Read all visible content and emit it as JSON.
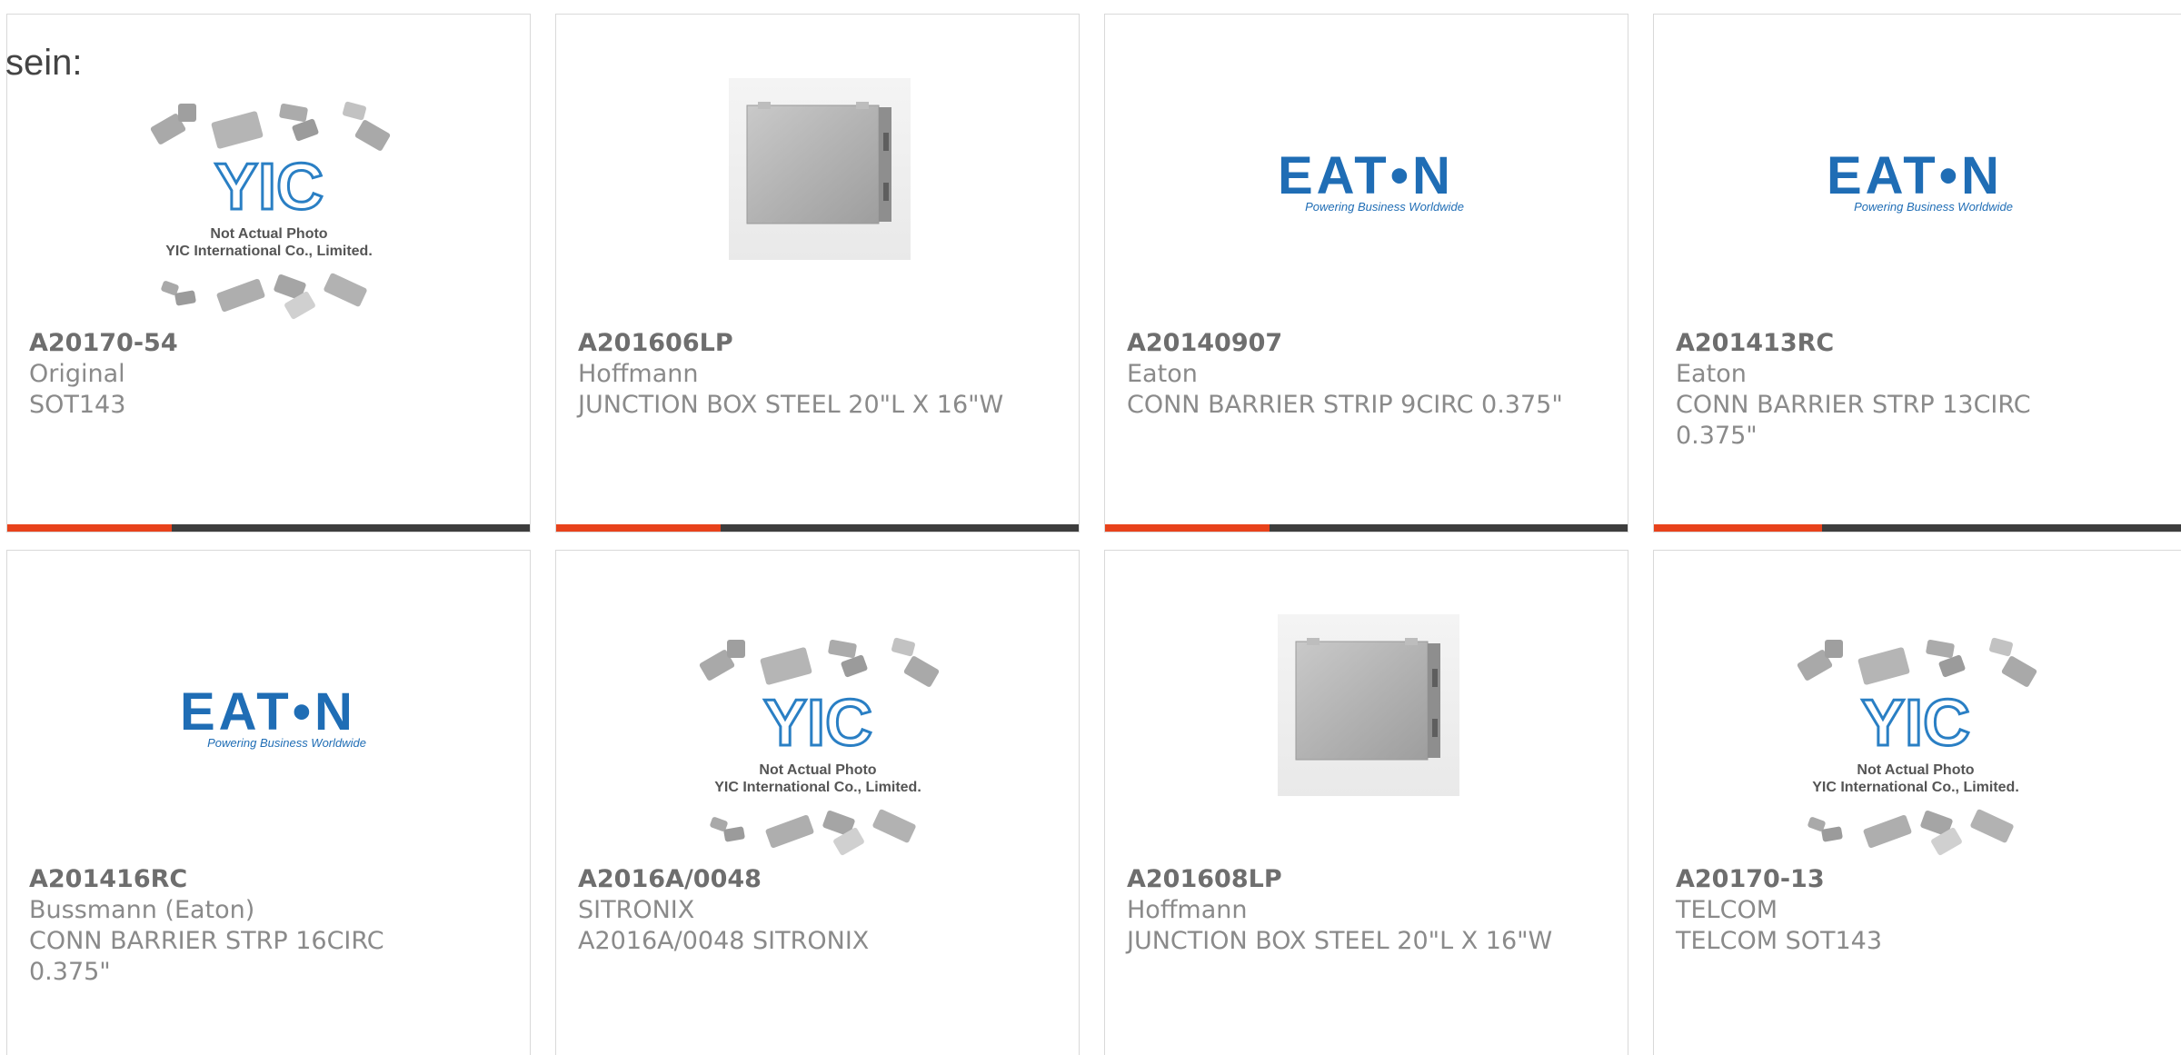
{
  "intro_text": "sein:",
  "colors": {
    "accent": "#e8421b",
    "track": "#3d3d3d",
    "border": "#d9d9d9",
    "eaton_blue": "#1f6db5",
    "yic_blue": "#2a7fc4"
  },
  "placeholder": {
    "caption_line1": "Not Actual Photo",
    "caption_line2": "YIC International Co., Limited.",
    "logo_text": "YIC"
  },
  "eaton_logo": {
    "wordmark": "EAT•N",
    "tagline": "Powering Business Worldwide"
  },
  "products": [
    {
      "part_no": "A20170-54",
      "manufacturer": "Original",
      "description": "SOT143",
      "image": "yic-placeholder",
      "progress": 0.315
    },
    {
      "part_no": "A201606LP",
      "manufacturer": "Hoffmann",
      "description": "JUNCTION BOX STEEL 20\"L X 16\"W",
      "image": "junction-box",
      "progress": 0.315
    },
    {
      "part_no": "A20140907",
      "manufacturer": "Eaton",
      "description": "CONN BARRIER STRIP 9CIRC 0.375\"",
      "image": "eaton-logo",
      "progress": 0.315
    },
    {
      "part_no": "A201413RC",
      "manufacturer": "Eaton",
      "description": "CONN BARRIER STRP 13CIRC 0.375\"",
      "image": "eaton-logo",
      "progress": 0.315
    },
    {
      "part_no": "A201416RC",
      "manufacturer": "Bussmann (Eaton)",
      "description": "CONN BARRIER STRP 16CIRC 0.375\"",
      "image": "eaton-logo"
    },
    {
      "part_no": "A2016A/0048",
      "manufacturer": "SITRONIX",
      "description": "A2016A/0048 SITRONIX",
      "image": "yic-placeholder"
    },
    {
      "part_no": "A201608LP",
      "manufacturer": "Hoffmann",
      "description": "JUNCTION BOX STEEL 20\"L X 16\"W",
      "image": "junction-box"
    },
    {
      "part_no": "A20170-13",
      "manufacturer": "TELCOM",
      "description": "TELCOM SOT143",
      "image": "yic-placeholder"
    }
  ]
}
